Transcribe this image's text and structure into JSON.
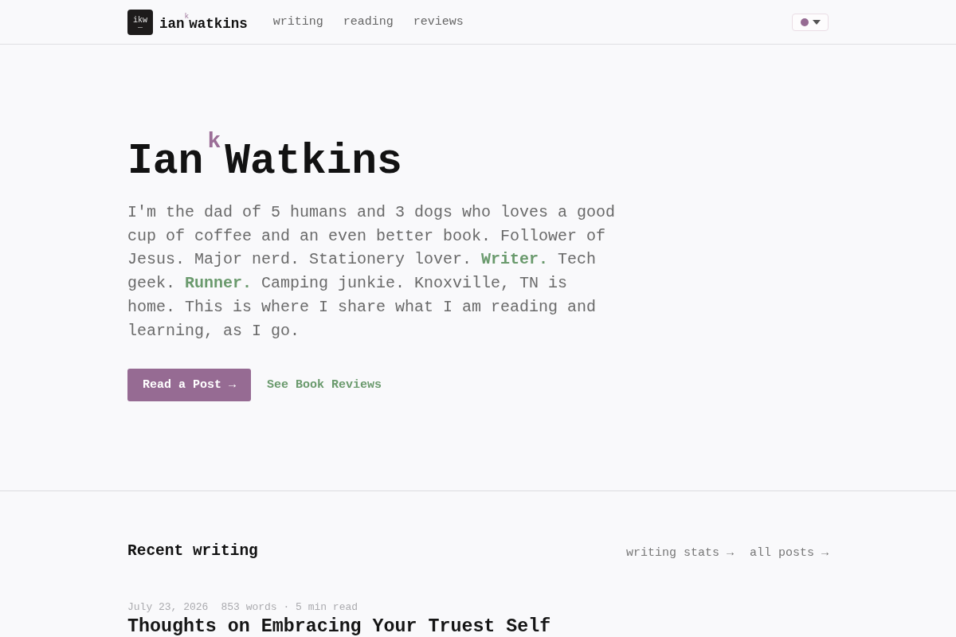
{
  "header": {
    "logo": {
      "mark": "ikw",
      "name": "ian$^{k}$watkins"
    },
    "nav": [
      "writing",
      "reading",
      "reviews"
    ]
  },
  "hero": {
    "title": "Ian$^{k}$Watkins",
    "bio": "I'm the dad of 5 humans and 3 dogs who loves a good cup of coffee and an even better book. Follower of Jesus. Major nerd. Stationery lover. **Writer.** Tech geek. **Runner.** Camping junkie. Knoxville, TN is home. This is where I share what I am reading and learning, as I go.",
    "buttons": [
      {
        "kind": "primary",
        "label": "Read a Post →"
      },
      {
        "kind": "link",
        "label": "See Book Reviews"
      }
    ]
  },
  "recent_writing": {
    "heading": "Recent writing",
    "links": [
      "writing stats →",
      "all posts →"
    ],
    "posts": [
      {
        "date": "July 23, 2026",
        "stats": "853 words · 5 min read",
        "title": "Thoughts on Embracing Your Truest Self"
      }
    ]
  }
}
